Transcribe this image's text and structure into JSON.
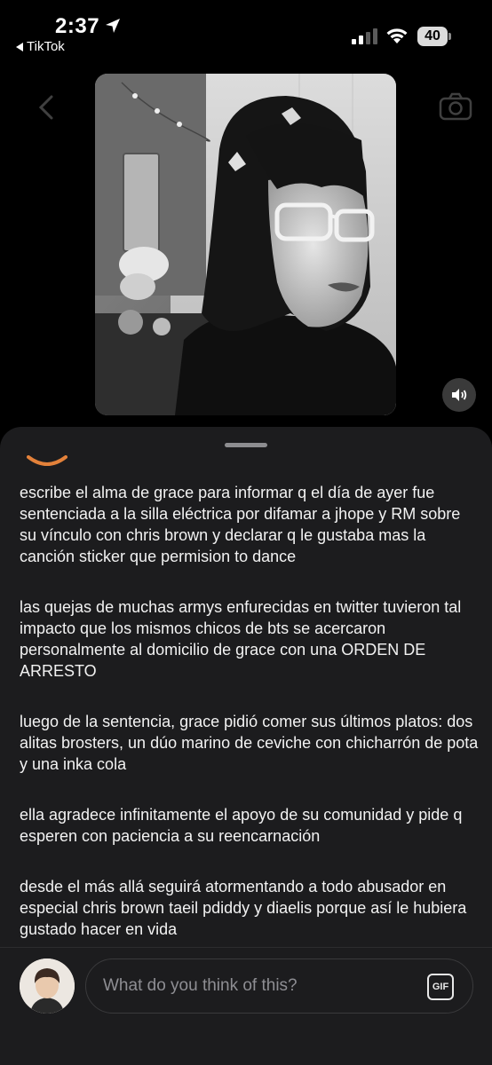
{
  "status_bar": {
    "time": "2:37",
    "back_app": "TikTok",
    "battery": "40",
    "location_icon": "location-arrow-icon",
    "signal_icon": "cellular-signal-icon",
    "wifi_icon": "wifi-icon"
  },
  "media": {
    "type": "photo",
    "sound_icon": "speaker-icon"
  },
  "comment": {
    "paragraphs": [
      "escribe el alma de grace para informar q el día de ayer fue sentenciada a la silla eléctrica por difamar a jhope y RM sobre su vínculo con chris brown y declarar q le gustaba mas la canción sticker que permision to dance",
      "las quejas de muchas armys enfurecidas en twitter tuvieron tal impacto que los mismos chicos de bts se acercaron personalmente al domicilio de grace con una ORDEN DE ARRESTO",
      "luego de la sentencia, grace pidió comer sus últimos platos: dos alitas brosters, un dúo marino de ceviche con chicharrón de pota y una inka cola",
      "ella agradece infinitamente el apoyo de su comunidad y pide q esperen con paciencia a su reencarnación",
      "desde el más allá seguirá atormentando a todo abusador en especial chris brown taeil pdiddy y diaelis porque así le hubiera gustado hacer en vida"
    ]
  },
  "composer": {
    "placeholder": "What do you think of this?",
    "gif_label": "GIF"
  },
  "colors": {
    "background": "#000000",
    "sheet": "#1c1c1e",
    "text": "#f2f2f2",
    "placeholder": "#8e8e93"
  }
}
